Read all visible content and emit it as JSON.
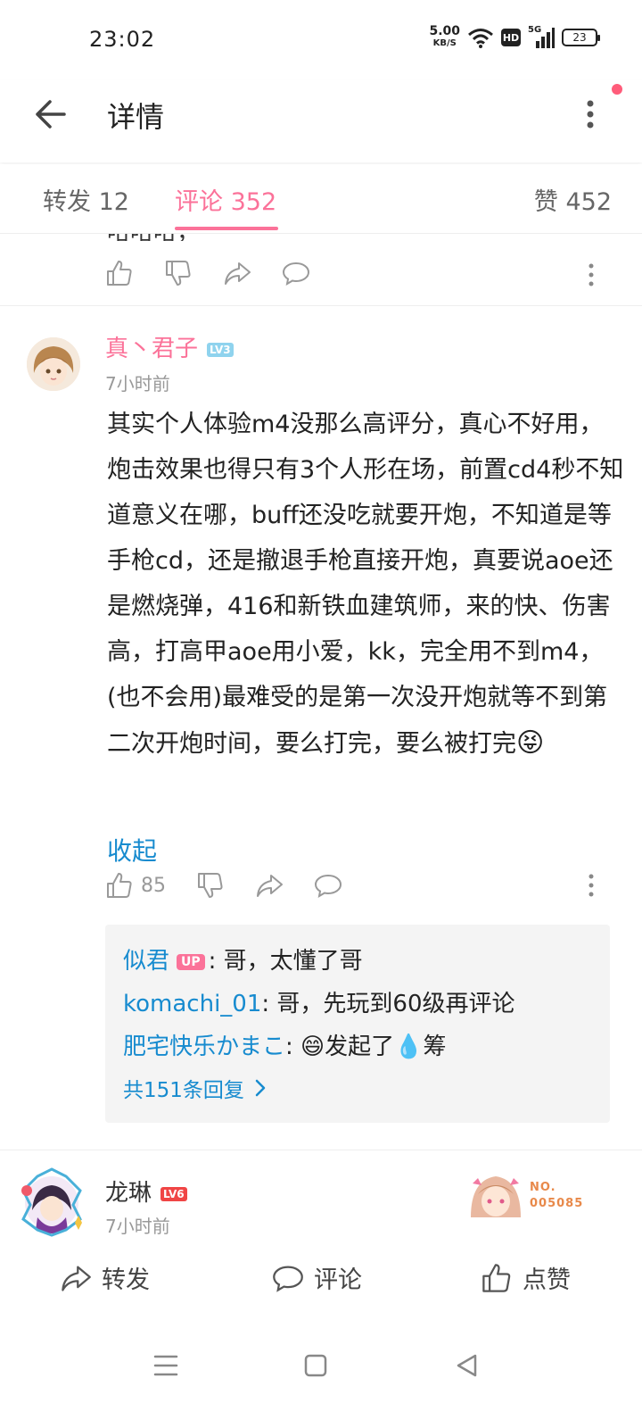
{
  "status_bar": {
    "time": "23:02",
    "net_speed": "5.00",
    "net_unit": "KB/S",
    "hd_label": "HD",
    "network_label": "5G",
    "battery": "23"
  },
  "header": {
    "title": "详情"
  },
  "tabs": [
    {
      "label": "转发 12"
    },
    {
      "label": "评论 352"
    },
    {
      "label": "赞 452"
    }
  ],
  "previous_comment": {
    "text_fragment": "哈哈哈，"
  },
  "comment": {
    "username": "真丶君子",
    "level": "LV3",
    "time": "7小时前",
    "text": "其实个人体验m4没那么高评分，真心不好用，炮击效果也得只有3个人形在场，前置cd4秒不知道意义在哪，buff还没吃就要开炮，不知道是等手枪cd，还是撤退手枪直接开炮，真要说aoe还是燃烧弹，416和新铁血建筑师，来的快、伤害高，打高甲aoe用小爱，kk，完全用不到m4，(也不会用)最难受的是第一次没开炮就等不到第二次开炮时间，要么打完，要么被打完",
    "emoji": "😝",
    "collapse_label": "收起",
    "like_count": "85"
  },
  "replies": {
    "items": [
      {
        "name": "似君",
        "badge": "UP",
        "text": ": 哥，太懂了哥"
      },
      {
        "name": "komachi_01",
        "badge": "",
        "text": ": 哥，先玩到60级再评论"
      },
      {
        "name": "肥宅快乐かまこ",
        "badge": "",
        "text": ": 😄发起了💧筹"
      }
    ],
    "total_label": "共151条回复"
  },
  "next_comment": {
    "username": "龙琳",
    "level": "LV6",
    "time": "7小时前",
    "medal_line1": "NO.",
    "medal_line2": "005085"
  },
  "bottom_bar": {
    "repost_label": "转发",
    "comment_label": "评论",
    "like_label": "点赞"
  },
  "colors": {
    "accent_pink": "#fb7299",
    "link_blue": "#178bcf",
    "muted_gray": "#999999"
  }
}
